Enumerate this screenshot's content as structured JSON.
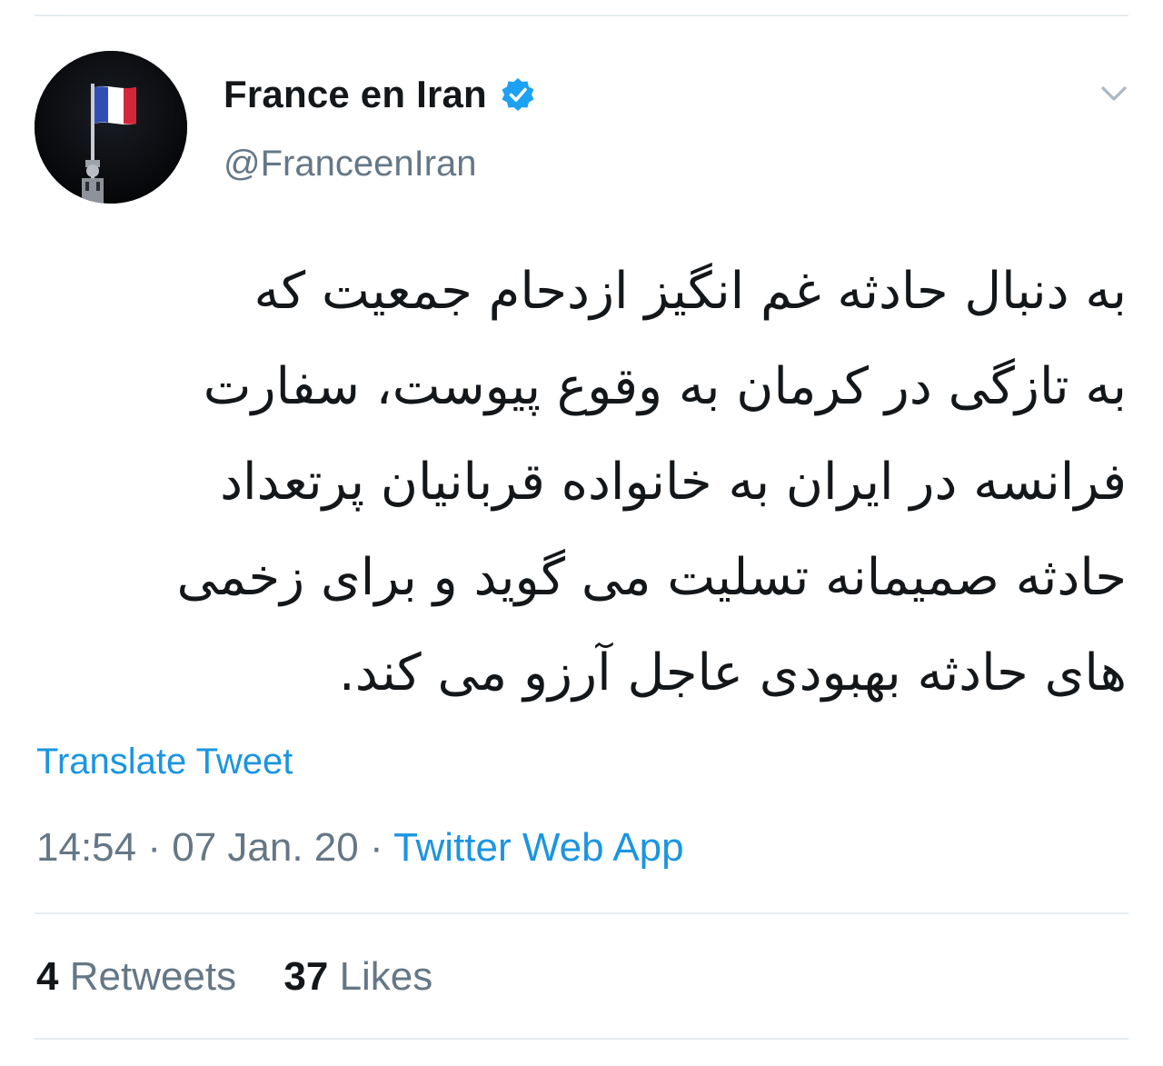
{
  "tweet": {
    "display_name": "France en Iran",
    "handle": "@FranceenIran",
    "verified_icon": "verified-badge-icon",
    "menu_icon": "chevron-down-icon",
    "text_lines": [
      "به دنبال حادثه غم انگیز ازدحام جمعیت که",
      "به تازگی در کرمان به وقوع پیوست، سفارت",
      "فرانسه در ایران به خانواده قربانیان پرتعداد",
      "حادثه صمیمانه تسلیت می گوید و برای زخمی",
      "های حادثه بهبودی عاجل آرزو می کند."
    ],
    "translate_label": "Translate Tweet",
    "time": "14:54",
    "date": "07 Jan. 20",
    "separator": "·",
    "source": "Twitter Web App",
    "retweets_count": "4",
    "retweets_label": "Retweets",
    "likes_count": "37",
    "likes_label": "Likes"
  },
  "colors": {
    "link": "#1b95e0",
    "secondary_text": "#657786",
    "primary_text": "#14171a",
    "divider": "#e6ecf0"
  }
}
